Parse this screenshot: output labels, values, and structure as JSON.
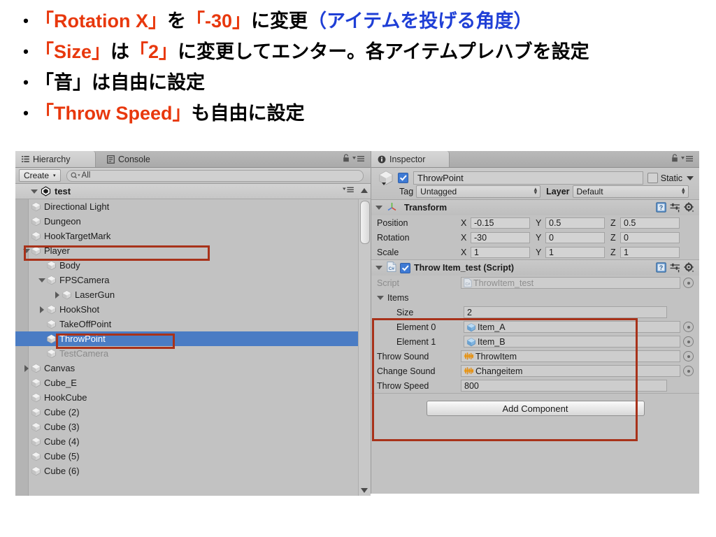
{
  "slide": {
    "bullets": [
      [
        {
          "t": "「Rotation X」",
          "c": "red"
        },
        {
          "t": "を",
          "c": "black"
        },
        {
          "t": "「-30」",
          "c": "red"
        },
        {
          "t": "に変更",
          "c": "black"
        },
        {
          "t": "（アイテムを投げる角度）",
          "c": "blue"
        }
      ],
      [
        {
          "t": "「Size」",
          "c": "red"
        },
        {
          "t": "は",
          "c": "black"
        },
        {
          "t": "「2」",
          "c": "red"
        },
        {
          "t": "に変更してエンター。各アイテムプレハブを設定",
          "c": "black"
        }
      ],
      [
        {
          "t": "「音」は自由に設定",
          "c": "black"
        }
      ],
      [
        {
          "t": "「Throw Speed」",
          "c": "red"
        },
        {
          "t": "も自由に設定",
          "c": "black"
        }
      ]
    ],
    "bullet_marker": "•"
  },
  "hierarchy": {
    "tabs": [
      {
        "label": "Hierarchy",
        "icon": "hierarchy-icon",
        "active": true
      },
      {
        "label": "Console",
        "icon": "console-icon",
        "active": false
      }
    ],
    "lock_icon": "lock-icon",
    "menu_icon": "panel-menu-icon",
    "toolbar": {
      "create_label": "Create",
      "create_caret": "▾",
      "search_icon": "search-icon",
      "search_value": "All",
      "search_placeholder": "All"
    },
    "scene_root": {
      "label": "test",
      "icon": "unity-scene-icon",
      "expanded": true,
      "menu_icon": "scene-menu-icon"
    },
    "items": [
      {
        "label": "Directional Light",
        "depth": 1,
        "toggle": "none",
        "state": "normal"
      },
      {
        "label": "Dungeon",
        "depth": 1,
        "toggle": "none",
        "state": "normal"
      },
      {
        "label": "HookTargetMark",
        "depth": 1,
        "toggle": "none",
        "state": "normal"
      },
      {
        "label": "Player",
        "depth": 1,
        "toggle": "down",
        "state": "normal"
      },
      {
        "label": "Body",
        "depth": 2,
        "toggle": "none",
        "state": "normal"
      },
      {
        "label": "FPSCamera",
        "depth": 2,
        "toggle": "down",
        "state": "normal"
      },
      {
        "label": "LaserGun",
        "depth": 3,
        "toggle": "right",
        "state": "normal"
      },
      {
        "label": "HookShot",
        "depth": 2,
        "toggle": "right",
        "state": "normal"
      },
      {
        "label": "TakeOffPoint",
        "depth": 2,
        "toggle": "none",
        "state": "normal"
      },
      {
        "label": "ThrowPoint",
        "depth": 2,
        "toggle": "none",
        "state": "selected"
      },
      {
        "label": "TestCamera",
        "depth": 2,
        "toggle": "none",
        "state": "disabled"
      },
      {
        "label": "Canvas",
        "depth": 1,
        "toggle": "right",
        "state": "normal"
      },
      {
        "label": "Cube_E",
        "depth": 1,
        "toggle": "none",
        "state": "normal"
      },
      {
        "label": "HookCube",
        "depth": 1,
        "toggle": "none",
        "state": "normal"
      },
      {
        "label": "Cube (2)",
        "depth": 1,
        "toggle": "none",
        "state": "normal"
      },
      {
        "label": "Cube (3)",
        "depth": 1,
        "toggle": "none",
        "state": "normal"
      },
      {
        "label": "Cube (4)",
        "depth": 1,
        "toggle": "none",
        "state": "normal"
      },
      {
        "label": "Cube (5)",
        "depth": 1,
        "toggle": "none",
        "state": "normal"
      },
      {
        "label": "Cube (6)",
        "depth": 1,
        "toggle": "none",
        "state": "normal"
      }
    ]
  },
  "inspector": {
    "tab_label": "Inspector",
    "tab_icon": "info-icon",
    "lock_icon": "lock-icon",
    "menu_icon": "panel-menu-icon",
    "gameobject": {
      "enabled": true,
      "name": "ThrowPoint",
      "static_label": "Static",
      "static_checked": false,
      "tag_label": "Tag",
      "tag_value": "Untagged",
      "layer_label": "Layer",
      "layer_value": "Default",
      "prefab_icon": "prefab-cube-icon"
    },
    "transform": {
      "title": "Transform",
      "icon": "transform-axis-icon",
      "help_icon": "help-book-icon",
      "preset_icon": "preset-icon",
      "gear_icon": "gear-icon",
      "rows": [
        {
          "label": "Position",
          "x": "-0.15",
          "y": "0.5",
          "z": "0.5"
        },
        {
          "label": "Rotation",
          "x": "-30",
          "y": "0",
          "z": "0"
        },
        {
          "label": "Scale",
          "x": "1",
          "y": "1",
          "z": "1"
        }
      ],
      "axis_labels": [
        "X",
        "Y",
        "Z"
      ]
    },
    "script_component": {
      "title": "Throw Item_test (Script)",
      "icon": "csharp-script-icon",
      "enabled": true,
      "help_icon": "help-book-icon",
      "preset_icon": "preset-icon",
      "gear_icon": "gear-icon",
      "script_label": "Script",
      "script_value": "ThrowItem_test",
      "array": {
        "label": "Items",
        "expanded": true,
        "size_label": "Size",
        "size_value": "2",
        "elements": [
          {
            "label": "Element 0",
            "value": "Item_A",
            "icon": "prefab-cube-icon"
          },
          {
            "label": "Element 1",
            "value": "Item_B",
            "icon": "prefab-cube-icon"
          }
        ]
      },
      "fields": [
        {
          "label": "Throw Sound",
          "value": "ThrowItem",
          "icon": "audio-clip-icon",
          "kind": "object"
        },
        {
          "label": "Change Sound",
          "value": "Changeitem",
          "icon": "audio-clip-icon",
          "kind": "object"
        },
        {
          "label": "Throw Speed",
          "value": "800",
          "icon": "",
          "kind": "text"
        }
      ]
    },
    "add_component_label": "Add Component"
  },
  "colors": {
    "highlight_red": "#a8321a",
    "selection_blue": "#4a7cc4",
    "text_red": "#e8380d",
    "text_blue": "#1f3fd6",
    "panel_bg": "#c2c2c2"
  }
}
